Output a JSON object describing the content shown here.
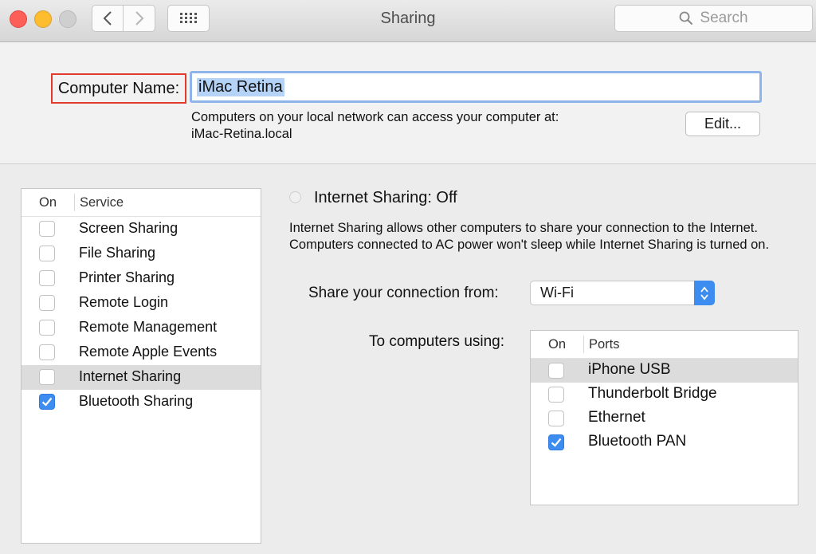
{
  "window": {
    "title": "Sharing",
    "search_placeholder": "Search"
  },
  "computer_name": {
    "label": "Computer Name:",
    "value": "iMac Retina",
    "description_line1": "Computers on your local network can access your computer at:",
    "description_line2": "iMac-Retina.local",
    "edit_label": "Edit..."
  },
  "services": {
    "header_on": "On",
    "header_service": "Service",
    "items": [
      {
        "label": "Screen Sharing",
        "checked": false,
        "selected": false
      },
      {
        "label": "File Sharing",
        "checked": false,
        "selected": false
      },
      {
        "label": "Printer Sharing",
        "checked": false,
        "selected": false
      },
      {
        "label": "Remote Login",
        "checked": false,
        "selected": false
      },
      {
        "label": "Remote Management",
        "checked": false,
        "selected": false
      },
      {
        "label": "Remote Apple Events",
        "checked": false,
        "selected": false
      },
      {
        "label": "Internet Sharing",
        "checked": false,
        "selected": true
      },
      {
        "label": "Bluetooth Sharing",
        "checked": true,
        "selected": false
      }
    ]
  },
  "internet_sharing": {
    "status_title": "Internet Sharing: Off",
    "description": "Internet Sharing allows other computers to share your connection to the Internet. Computers connected to AC power won't sleep while Internet Sharing is turned on.",
    "share_from_label": "Share your connection from:",
    "share_from_value": "Wi-Fi",
    "to_computers_label": "To computers using:",
    "ports_header_on": "On",
    "ports_header_ports": "Ports",
    "ports": [
      {
        "label": "iPhone USB",
        "checked": false,
        "selected": true
      },
      {
        "label": "Thunderbolt Bridge",
        "checked": false,
        "selected": false
      },
      {
        "label": "Ethernet",
        "checked": false,
        "selected": false
      },
      {
        "label": "Bluetooth PAN",
        "checked": true,
        "selected": false
      }
    ]
  },
  "colors": {
    "accent": "#3d8cf0",
    "highlight_box": "#e23a2b",
    "selection": "#b5d3f7"
  }
}
